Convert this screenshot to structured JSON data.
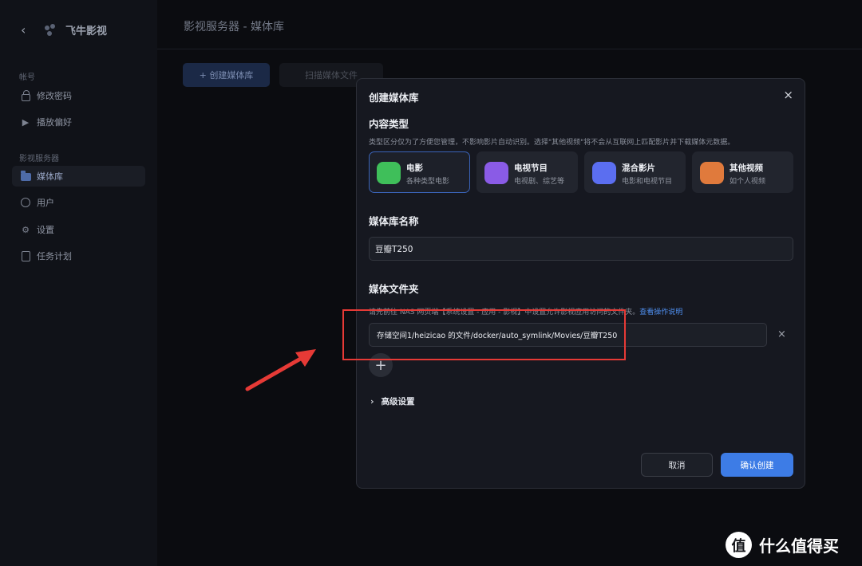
{
  "sidebar": {
    "brand_name": "飞牛影视",
    "groups": [
      {
        "label": "帐号",
        "items": [
          {
            "label": "修改密码"
          },
          {
            "label": "播放偏好"
          }
        ]
      },
      {
        "label": "影视服务器",
        "items": [
          {
            "label": "媒体库"
          },
          {
            "label": "用户"
          },
          {
            "label": "设置"
          },
          {
            "label": "任务计划"
          }
        ]
      }
    ]
  },
  "main": {
    "title": "影视服务器 - 媒体库",
    "create_button_label": "+ 创建媒体库",
    "scan_button_label": "扫描媒体文件"
  },
  "modal": {
    "title": "创建媒体库",
    "content_type_title": "内容类型",
    "content_type_hint": "类型区分仅为了方便您管理，不影响影片自动识别。选择\"其他视频\"将不会从互联网上匹配影片并下载媒体元数据。",
    "types": [
      {
        "name": "电影",
        "desc": "各种类型电影",
        "icon": "movie-icon",
        "color": "#3fbf5a",
        "selected": true
      },
      {
        "name": "电视节目",
        "desc": "电视剧、综艺等",
        "icon": "tv-show-icon",
        "color": "#8a5be6",
        "selected": false
      },
      {
        "name": "混合影片",
        "desc": "电影和电视节目",
        "icon": "mixed-media-icon",
        "color": "#5b6ef0",
        "selected": false
      },
      {
        "name": "其他视频",
        "desc": "如个人视频",
        "icon": "video-camera-icon",
        "color": "#e07a3c",
        "selected": false
      }
    ],
    "name_title": "媒体库名称",
    "name_value": "豆瓣T250",
    "folder_title": "媒体文件夹",
    "folder_hint": "请先前往 NAS 网页端【系统设置 - 应用 - 影视】中设置允许影视应用访问的文件夹。",
    "folder_hint_link": "查看操作说明",
    "folder_value": "存储空间1/heizicao 的文件/docker/auto_symlink/Movies/豆瓣T250",
    "advanced_label": "高级设置",
    "cancel_label": "取消",
    "confirm_label": "确认创建"
  },
  "watermark": {
    "badge": "值",
    "text": "什么值得买"
  },
  "colors": {
    "accent": "#3d7ce6",
    "annotation": "#e63a36",
    "background": "#0b0c10"
  }
}
